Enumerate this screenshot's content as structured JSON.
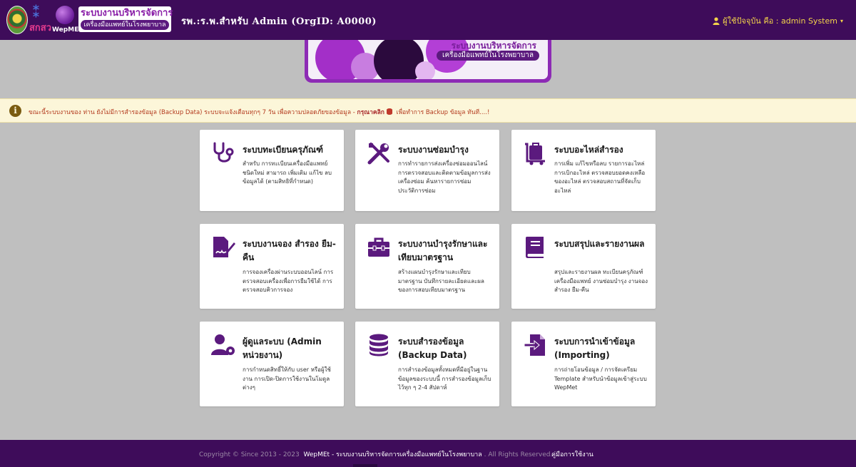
{
  "header": {
    "logo_sks_text": "สกสว",
    "logo_wep_text": "WepMEt",
    "brand_title": "ระบบงานบริหารจัดการ",
    "brand_subtitle": "เครื่องมือแพทย์ในโรงพยาบาล",
    "org_title": "รพ.:ร.พ.สำหรับ Admin (OrgID: A0000)",
    "user_label": "ผู้ใช้ปัจจุบัน คือ : admin System",
    "user_caret": "▾"
  },
  "banner": {
    "title": "ระบบงานบริหารจัดการ",
    "subtitle": "เครื่องมือแพทย์ในโรงพยาบาล"
  },
  "alert": {
    "icon": "i",
    "message_prefix": "ขณะนี้ระบบงานของ ท่าน ยังไม่มีการสำรองข้อมูล (Backup Data) ระบบจะแจ้งเตือนทุกๆ 7 วัน เพื่อความปลอดภัยของข้อมูล - ",
    "message_bold": "กรุณาคลิก",
    "message_suffix": " เพื่อทำการ Backup ข้อมูล ทันที....!"
  },
  "colors": {
    "accent": "#5b1a7e",
    "header_bg": "#3e0c5a",
    "alert_text": "#b33a1e"
  },
  "cards": [
    {
      "icon": "stethoscope-icon",
      "title": "ระบบทะเบียนครุภัณฑ์",
      "description": "สำหรับ การทะเบียนเครื่องมือแพทย์ชนิดใหม่ สามารถ เพิ่มเติม แก้ไข ลบข้อมูลได้ (ตามสิทธิที่กำหนด)"
    },
    {
      "icon": "tools-icon",
      "title": "ระบบงานซ่อมบำรุง",
      "description": "การทำรายการส่งเครื่องซ่อมออนไลน์ การตรวจสอบและติดตามข้อมูลการส่งเครื่องซ่อม ค้นหารายการซ่อมประวัติการซ่อม"
    },
    {
      "icon": "dolly-icon",
      "title": "ระบบอะไหล่สำรอง",
      "description": "การเพิ่ม แก้ไขหรือลบ รายการอะไหล่ การเบิกอะไหล่ ตรวจสอบยอดคงเหลือของอะไหล่ ตรวจสอบสถานที่จัดเก็บอะไหล่"
    },
    {
      "icon": "signature-icon",
      "title": "ระบบงานจอง สำรอง ยืม-คืน",
      "description": "การจองเครื่องผ่านระบบออนไลน์ การตรวจสอบเครื่องเพื่อการยืมใช้ได้ การตรวจสอบคิวการจอง"
    },
    {
      "icon": "toolbox-icon",
      "title": "ระบบงานบำรุงรักษาและเทียบมาตรฐาน",
      "description": "สร้างแผนบำรุงรักษาและเทียบมาตรฐาน บันทึกรายละเอียดและผลของการสอบเทียบมาตรฐาน"
    },
    {
      "icon": "book-icon",
      "title": "ระบบสรุปและรายงานผล",
      "description": "สรุปและรายงานผล ทะเบียนครุภัณฑ์เครื่องมือแพทย์ งานซ่อมบำรุง งานจอง สำรอง ยืม-คืน"
    },
    {
      "icon": "user-cog-icon",
      "title": "ผู้ดูแลระบบ (Admin หน่วยงาน)",
      "description": "การกำหนดสิทธิ์ให้กับ user หรือผู้ใช้งาน การเปิด-ปิดการใช้งานในโมดูลต่างๆ"
    },
    {
      "icon": "database-icon",
      "title": "ระบบสำรองข้อมูล (Backup Data)",
      "description": "การสำรองข้อมูลทั้งหมดที่มีอยู่ในฐานข้อมูลของระบบนี้ การสำรองข้อมูลเก็บไว้ทุก ๆ 2-4 สัปดาห์"
    },
    {
      "icon": "file-import-icon",
      "title": "ระบบการนำเข้าข้อมูล (Importing)",
      "description": "การถ่ายโอนข้อมูล / การจัดเตรียม Template สำหรับนำข้อมูลเข้าสู่ระบบ WepMet"
    }
  ],
  "footer": {
    "copyright": "Copyright © Since 2013 - 2023",
    "app_name": "WepMEt - ระบบงานบริหารจัดการเครื่องมือแพทย์ในโรงพยาบาล",
    "rights": ". All Rights Reserved.",
    "manual_link": "คู่มือการใช้งาน"
  }
}
